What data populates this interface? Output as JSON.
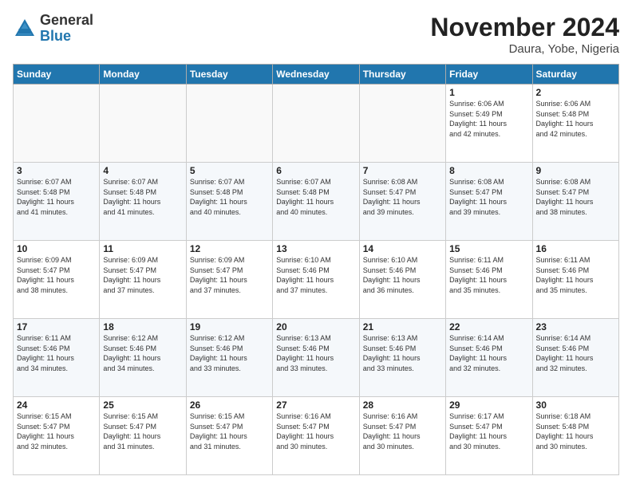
{
  "logo": {
    "general": "General",
    "blue": "Blue"
  },
  "header": {
    "month": "November 2024",
    "location": "Daura, Yobe, Nigeria"
  },
  "weekdays": [
    "Sunday",
    "Monday",
    "Tuesday",
    "Wednesday",
    "Thursday",
    "Friday",
    "Saturday"
  ],
  "weeks": [
    [
      {
        "day": "",
        "info": ""
      },
      {
        "day": "",
        "info": ""
      },
      {
        "day": "",
        "info": ""
      },
      {
        "day": "",
        "info": ""
      },
      {
        "day": "",
        "info": ""
      },
      {
        "day": "1",
        "info": "Sunrise: 6:06 AM\nSunset: 5:49 PM\nDaylight: 11 hours\nand 42 minutes."
      },
      {
        "day": "2",
        "info": "Sunrise: 6:06 AM\nSunset: 5:48 PM\nDaylight: 11 hours\nand 42 minutes."
      }
    ],
    [
      {
        "day": "3",
        "info": "Sunrise: 6:07 AM\nSunset: 5:48 PM\nDaylight: 11 hours\nand 41 minutes."
      },
      {
        "day": "4",
        "info": "Sunrise: 6:07 AM\nSunset: 5:48 PM\nDaylight: 11 hours\nand 41 minutes."
      },
      {
        "day": "5",
        "info": "Sunrise: 6:07 AM\nSunset: 5:48 PM\nDaylight: 11 hours\nand 40 minutes."
      },
      {
        "day": "6",
        "info": "Sunrise: 6:07 AM\nSunset: 5:48 PM\nDaylight: 11 hours\nand 40 minutes."
      },
      {
        "day": "7",
        "info": "Sunrise: 6:08 AM\nSunset: 5:47 PM\nDaylight: 11 hours\nand 39 minutes."
      },
      {
        "day": "8",
        "info": "Sunrise: 6:08 AM\nSunset: 5:47 PM\nDaylight: 11 hours\nand 39 minutes."
      },
      {
        "day": "9",
        "info": "Sunrise: 6:08 AM\nSunset: 5:47 PM\nDaylight: 11 hours\nand 38 minutes."
      }
    ],
    [
      {
        "day": "10",
        "info": "Sunrise: 6:09 AM\nSunset: 5:47 PM\nDaylight: 11 hours\nand 38 minutes."
      },
      {
        "day": "11",
        "info": "Sunrise: 6:09 AM\nSunset: 5:47 PM\nDaylight: 11 hours\nand 37 minutes."
      },
      {
        "day": "12",
        "info": "Sunrise: 6:09 AM\nSunset: 5:47 PM\nDaylight: 11 hours\nand 37 minutes."
      },
      {
        "day": "13",
        "info": "Sunrise: 6:10 AM\nSunset: 5:46 PM\nDaylight: 11 hours\nand 37 minutes."
      },
      {
        "day": "14",
        "info": "Sunrise: 6:10 AM\nSunset: 5:46 PM\nDaylight: 11 hours\nand 36 minutes."
      },
      {
        "day": "15",
        "info": "Sunrise: 6:11 AM\nSunset: 5:46 PM\nDaylight: 11 hours\nand 35 minutes."
      },
      {
        "day": "16",
        "info": "Sunrise: 6:11 AM\nSunset: 5:46 PM\nDaylight: 11 hours\nand 35 minutes."
      }
    ],
    [
      {
        "day": "17",
        "info": "Sunrise: 6:11 AM\nSunset: 5:46 PM\nDaylight: 11 hours\nand 34 minutes."
      },
      {
        "day": "18",
        "info": "Sunrise: 6:12 AM\nSunset: 5:46 PM\nDaylight: 11 hours\nand 34 minutes."
      },
      {
        "day": "19",
        "info": "Sunrise: 6:12 AM\nSunset: 5:46 PM\nDaylight: 11 hours\nand 33 minutes."
      },
      {
        "day": "20",
        "info": "Sunrise: 6:13 AM\nSunset: 5:46 PM\nDaylight: 11 hours\nand 33 minutes."
      },
      {
        "day": "21",
        "info": "Sunrise: 6:13 AM\nSunset: 5:46 PM\nDaylight: 11 hours\nand 33 minutes."
      },
      {
        "day": "22",
        "info": "Sunrise: 6:14 AM\nSunset: 5:46 PM\nDaylight: 11 hours\nand 32 minutes."
      },
      {
        "day": "23",
        "info": "Sunrise: 6:14 AM\nSunset: 5:46 PM\nDaylight: 11 hours\nand 32 minutes."
      }
    ],
    [
      {
        "day": "24",
        "info": "Sunrise: 6:15 AM\nSunset: 5:47 PM\nDaylight: 11 hours\nand 32 minutes."
      },
      {
        "day": "25",
        "info": "Sunrise: 6:15 AM\nSunset: 5:47 PM\nDaylight: 11 hours\nand 31 minutes."
      },
      {
        "day": "26",
        "info": "Sunrise: 6:15 AM\nSunset: 5:47 PM\nDaylight: 11 hours\nand 31 minutes."
      },
      {
        "day": "27",
        "info": "Sunrise: 6:16 AM\nSunset: 5:47 PM\nDaylight: 11 hours\nand 30 minutes."
      },
      {
        "day": "28",
        "info": "Sunrise: 6:16 AM\nSunset: 5:47 PM\nDaylight: 11 hours\nand 30 minutes."
      },
      {
        "day": "29",
        "info": "Sunrise: 6:17 AM\nSunset: 5:47 PM\nDaylight: 11 hours\nand 30 minutes."
      },
      {
        "day": "30",
        "info": "Sunrise: 6:18 AM\nSunset: 5:48 PM\nDaylight: 11 hours\nand 30 minutes."
      }
    ]
  ]
}
